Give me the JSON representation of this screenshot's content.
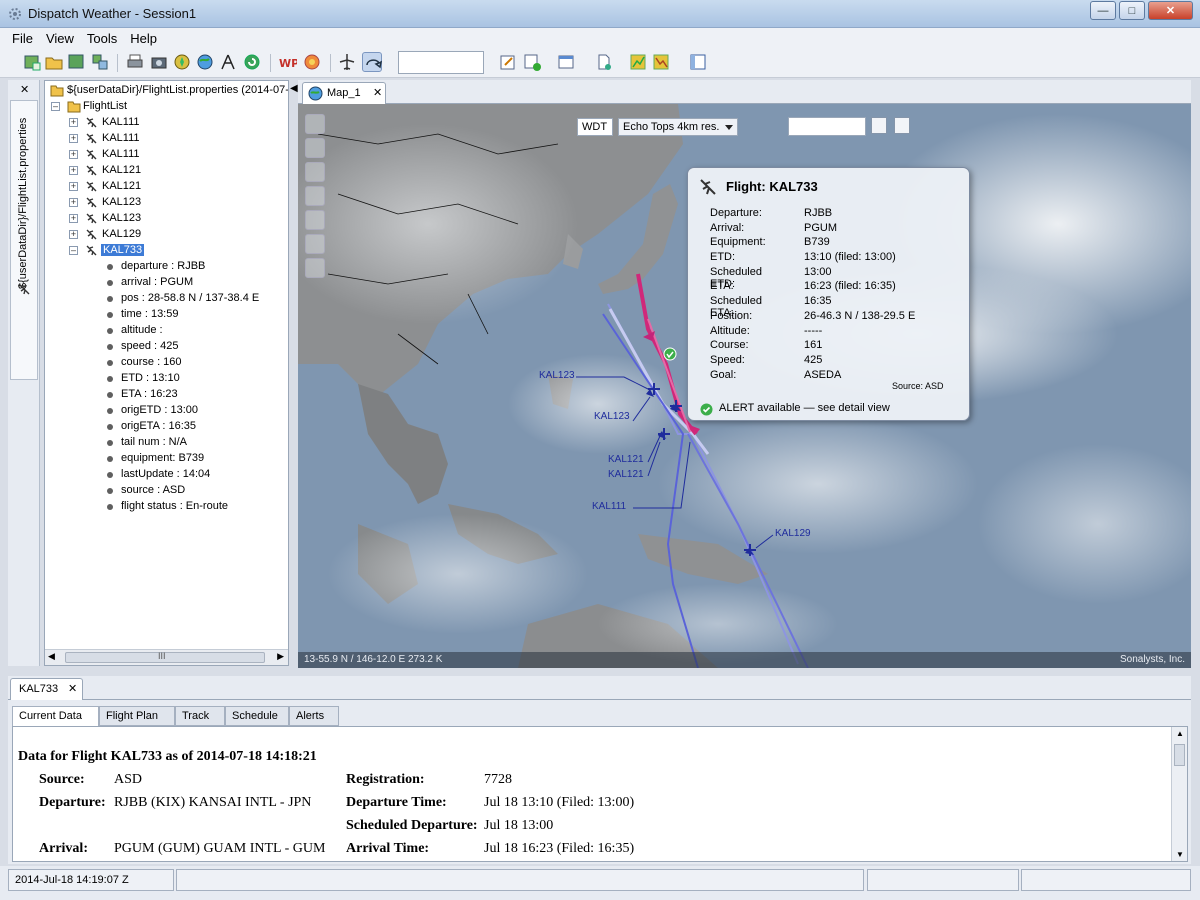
{
  "window": {
    "title": "Dispatch Weather - Session1"
  },
  "menu": [
    "File",
    "View",
    "Tools",
    "Help"
  ],
  "toolbar_icons": [
    "add-layer-icon",
    "open-folder-icon",
    "map-icon",
    "tile-icon",
    "print-icon",
    "camera-icon",
    "compass-icon",
    "globe-icon",
    "route-icon",
    "refresh-icon",
    "wp-icon",
    "weather-icon",
    "airplane-icon",
    "loop-icon",
    "edit-icon",
    "add-icon",
    "window-icon",
    "document-icon",
    "chart-a-icon",
    "chart-b-icon",
    "panel-icon"
  ],
  "left_tab": {
    "label": "${userDataDir}/FlightList.properties"
  },
  "tree": {
    "root": "${userDataDir}/FlightList.properties (2014-07-",
    "folder": "FlightList",
    "flights": [
      "KAL111",
      "KAL111",
      "KAL111",
      "KAL121",
      "KAL121",
      "KAL123",
      "KAL123",
      "KAL129"
    ],
    "selected": "KAL733",
    "attributes": [
      "departure : RJBB",
      "arrival  : PGUM",
      "pos : 28-58.8 N / 137-38.4 E",
      "time      : 13:59",
      "altitude  :",
      "speed     : 425",
      "course    : 160",
      "ETD       : 13:10",
      "ETA       : 16:23",
      "origETD  : 13:00",
      "origETA  : 16:35",
      "tail num :  N/A",
      "equipment: B739",
      "lastUpdate :  14:04",
      "source   : ASD",
      "flight status :  En-route"
    ],
    "scroll_grip": "III"
  },
  "map": {
    "tab": "Map_1",
    "wdt": "WDT",
    "layer": "Echo Tops 4km res.",
    "status_left": "13-55.9 N / 146-12.0 E   273.2 K",
    "status_right": "Sonalysts, Inc.",
    "labels": [
      "KAL123",
      "KAL123",
      "KAL121",
      "KAL121",
      "KAL111",
      "KAL129"
    ],
    "colors": {
      "route": "#5a63d8",
      "selected_route": "#d0287a",
      "flight": "#1f2c9c"
    }
  },
  "popup": {
    "title": "Flight: KAL733",
    "rows": [
      {
        "k": "Departure:",
        "v": "RJBB"
      },
      {
        "k": "Arrival:",
        "v": "PGUM"
      },
      {
        "k": "Equipment:",
        "v": "B739"
      },
      {
        "k": "ETD:",
        "v": "13:10  (filed: 13:00)"
      },
      {
        "k": "Scheduled ETD:",
        "v": "13:00"
      },
      {
        "k": "ETA:",
        "v": "16:23  (filed: 16:35)"
      },
      {
        "k": "Scheduled ETA:",
        "v": "16:35"
      },
      {
        "k": "Position:",
        "v": "26-46.3 N / 138-29.5 E"
      },
      {
        "k": "Altitude:",
        "v": "-----"
      },
      {
        "k": "Course:",
        "v": "161"
      },
      {
        "k": "Speed:",
        "v": "425"
      },
      {
        "k": "Goal:",
        "v": "ASEDA"
      }
    ],
    "source": "Source: ASD",
    "alert": "ALERT available — see detail view"
  },
  "detail": {
    "tab": "KAL733",
    "subtabs": [
      "Current Data",
      "Flight Plan",
      "Track",
      "Schedule",
      "Alerts"
    ],
    "heading": "Data for Flight KAL733 as of 2014-07-18 14:18:21",
    "fields": {
      "source_label": "Source:",
      "source": "ASD",
      "registration_label": "Registration:",
      "registration": "7728",
      "departure_label": "Departure:",
      "departure": "RJBB (KIX) KANSAI INTL - JPN",
      "departure_time_label": "Departure Time:",
      "departure_time": "Jul 18 13:10  (Filed: 13:00)",
      "sched_departure_label": "Scheduled Departure:",
      "sched_departure": "Jul 18 13:00",
      "arrival_label": "Arrival:",
      "arrival": "PGUM (GUM) GUAM INTL - GUM",
      "arrival_time_label": "Arrival Time:",
      "arrival_time": "Jul 18 16:23  (Filed: 16:35)"
    }
  },
  "statusbar": {
    "time": "2014-Jul-18 14:19:07 Z"
  }
}
